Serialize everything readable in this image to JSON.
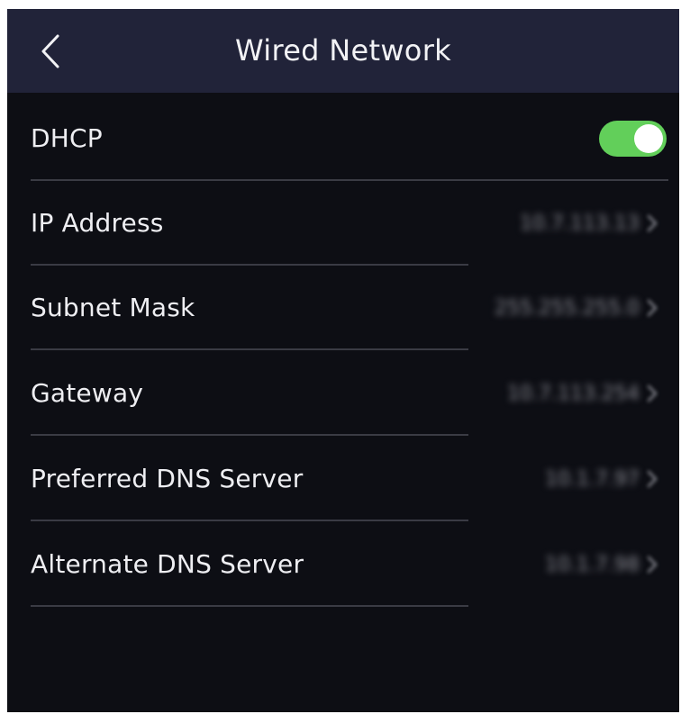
{
  "header": {
    "title": "Wired Network",
    "back_icon": "chevron-left-icon"
  },
  "dhcp": {
    "label": "DHCP",
    "enabled": true,
    "toggle_color": "#62cf5a"
  },
  "settings": [
    {
      "key": "ip_address",
      "label": "IP Address",
      "value": "10.7.113.13"
    },
    {
      "key": "subnet_mask",
      "label": "Subnet Mask",
      "value": "255.255.255.0"
    },
    {
      "key": "gateway",
      "label": "Gateway",
      "value": "10.7.113.254"
    },
    {
      "key": "preferred_dns",
      "label": "Preferred DNS Server",
      "value": "10.1.7.97"
    },
    {
      "key": "alternate_dns",
      "label": "Alternate DNS Server",
      "value": "10.1.7.98"
    }
  ],
  "colors": {
    "background": "#0d0e14",
    "header": "#212339",
    "text": "#eeeef2",
    "divider": "#3a3b44"
  }
}
